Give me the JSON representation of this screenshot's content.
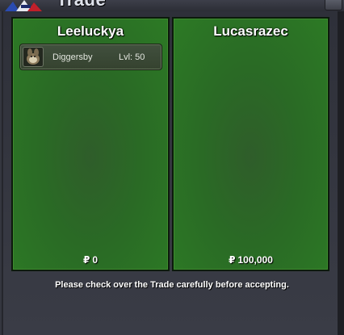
{
  "window": {
    "title": "Trade"
  },
  "trade": {
    "left": {
      "player": "Leeluckya",
      "currency_symbol": "₽",
      "money": "0",
      "items": [
        {
          "name": "Diggersby",
          "level": "Lvl: 50",
          "icon": "diggersby-icon"
        }
      ]
    },
    "right": {
      "player": "Lucasrazec",
      "currency_symbol": "₽",
      "money": "100,000",
      "items": []
    }
  },
  "notice": "Please check over the Trade carefully before accepting.",
  "colors": {
    "panel_green": "#2c7a25",
    "panel_border": "#3e8a2e",
    "window_bg": "#34363f",
    "text": "#ffffff"
  }
}
